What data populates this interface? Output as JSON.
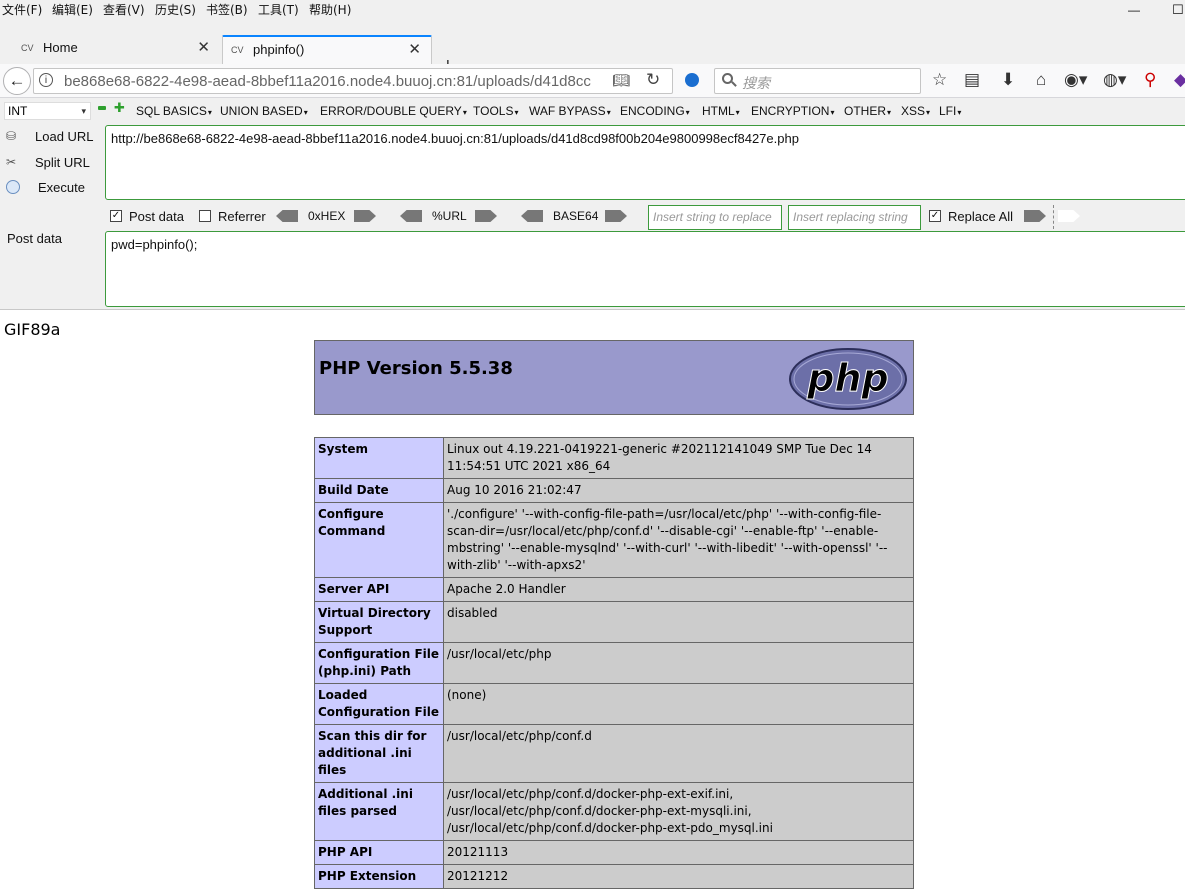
{
  "menubar": {
    "items": [
      "文件(F)",
      "编辑(E)",
      "查看(V)",
      "历史(S)",
      "书签(B)",
      "工具(T)",
      "帮助(H)"
    ],
    "minimize": "—",
    "maximize": "☐"
  },
  "tabs": [
    {
      "favicon": "CV",
      "title": "Home"
    },
    {
      "favicon": "CV",
      "title": "phpinfo()"
    }
  ],
  "navbar": {
    "url_display": "be868e68-6822-4e98-aead-8bbef11a2016.node4.buuoj.cn:81/uploads/d41d8cc",
    "search_placeholder": "搜索"
  },
  "hackbar": {
    "type_select": "INT",
    "menus": [
      "SQL BASICS",
      "UNION BASED",
      "ERROR/DOUBLE QUERY",
      "TOOLS",
      "WAF BYPASS",
      "ENCODING",
      "HTML",
      "ENCRYPTION",
      "OTHER",
      "XSS",
      "LFI"
    ],
    "load_url": "Load URL",
    "split_url": "Split URL",
    "execute": "Execute",
    "url_value": "http://be868e68-6822-4e98-aead-8bbef11a2016.node4.buuoj.cn:81/uploads/d41d8cd98f00b204e9800998ecf8427e.php",
    "post_data_checkbox": "Post data",
    "referrer_checkbox": "Referrer",
    "enc_hex": "0xHEX",
    "enc_url": "%URL",
    "enc_base64": "BASE64",
    "replace_find_placeholder": "Insert string to replace",
    "replace_with_placeholder": "Insert replacing string",
    "replace_all": "Replace All",
    "post_data_label": "Post data",
    "post_data_value": "pwd=phpinfo();",
    "post_data_checked": true,
    "referrer_checked": false,
    "replace_all_checked": true
  },
  "page": {
    "gif_header": "GIF89a",
    "php_version": "PHP Version 5.5.38",
    "rows": [
      {
        "key": "System",
        "value": "Linux out 4.19.221-0419221-generic #202112141049 SMP Tue Dec 14 11:54:51 UTC 2021 x86_64"
      },
      {
        "key": "Build Date",
        "value": "Aug 10 2016 21:02:47"
      },
      {
        "key": "Configure Command",
        "value": "'./configure' '--with-config-file-path=/usr/local/etc/php' '--with-config-file-scan-dir=/usr/local/etc/php/conf.d' '--disable-cgi' '--enable-ftp' '--enable-mbstring' '--enable-mysqlnd' '--with-curl' '--with-libedit' '--with-openssl' '--with-zlib' '--with-apxs2'"
      },
      {
        "key": "Server API",
        "value": "Apache 2.0 Handler"
      },
      {
        "key": "Virtual Directory Support",
        "value": "disabled"
      },
      {
        "key": "Configuration File (php.ini) Path",
        "value": "/usr/local/etc/php"
      },
      {
        "key": "Loaded Configuration File",
        "value": "(none)"
      },
      {
        "key": "Scan this dir for additional .ini files",
        "value": "/usr/local/etc/php/conf.d"
      },
      {
        "key": "Additional .ini files parsed",
        "value": "/usr/local/etc/php/conf.d/docker-php-ext-exif.ini, /usr/local/etc/php/conf.d/docker-php-ext-mysqli.ini, /usr/local/etc/php/conf.d/docker-php-ext-pdo_mysql.ini"
      },
      {
        "key": "PHP API",
        "value": "20121113"
      },
      {
        "key": "PHP Extension",
        "value": "20121212"
      }
    ]
  },
  "colors": {
    "php_header": "#9999cc",
    "php_key": "#ccccff",
    "php_value": "#cccccc",
    "hackbar_border": "#3c9a3c",
    "active_tab_accent": "#0a84ff"
  },
  "icons": [
    "back-arrow-icon",
    "info-icon",
    "reader-view-icon",
    "reload-icon",
    "search-icon",
    "bookmark-star-icon",
    "library-icon",
    "download-icon",
    "home-icon",
    "php-logo"
  ]
}
